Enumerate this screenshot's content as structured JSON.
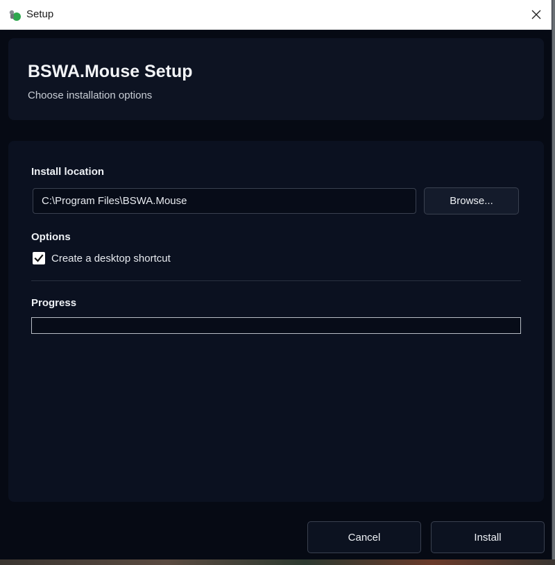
{
  "window": {
    "title": "Setup",
    "app_icon": "green-figure-icon",
    "close_icon": "close-icon"
  },
  "header": {
    "title": "BSWA.Mouse Setup",
    "subtitle": "Choose installation options"
  },
  "install_location": {
    "label": "Install location",
    "path_value": "C:\\Program Files\\BSWA.Mouse",
    "browse_label": "Browse..."
  },
  "options": {
    "label": "Options",
    "desktop_shortcut_label": "Create a desktop shortcut",
    "desktop_shortcut_checked": true
  },
  "progress": {
    "label": "Progress",
    "value_percent": 0
  },
  "footer": {
    "cancel_label": "Cancel",
    "install_label": "Install"
  },
  "colors": {
    "window_bg": "#060a14",
    "panel_bg": "#0b1120",
    "border": "#3a4150",
    "text": "#eef1f5"
  }
}
